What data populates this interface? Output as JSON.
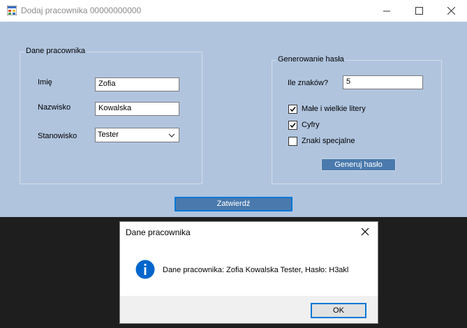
{
  "window": {
    "title": "Dodaj pracownika 00000000000",
    "icons": {
      "app": "app-form-icon",
      "minimize": "minimize-icon",
      "maximize": "maximize-icon",
      "close": "close-icon"
    }
  },
  "employee_group": {
    "title": "Dane pracownika",
    "first_name_label": "Imię",
    "first_name_value": "Zofia",
    "last_name_label": "Nazwisko",
    "last_name_value": "Kowalska",
    "position_label": "Stanowisko",
    "position_value": "Tester"
  },
  "password_group": {
    "title": "Generowanie hasła",
    "length_label": "Ile znaków?",
    "length_value": "5",
    "checkboxes": [
      {
        "label": "Małe i wielkie litery",
        "checked": true
      },
      {
        "label": "Cyfry",
        "checked": true
      },
      {
        "label": "Znaki specjalne",
        "checked": false
      }
    ],
    "generate_button": "Generuj hasło"
  },
  "submit_button": "Zatwierdź",
  "dialog": {
    "title": "Dane pracownika",
    "message": "Dane pracownika: Zofia Kowalska Tester, Hasło: H3akl",
    "ok_button": "OK",
    "icon": "info-icon"
  },
  "colors": {
    "form_background": "#b0c4de",
    "button_blue": "#4a7aad",
    "info_blue": "#0066cc",
    "desktop_dark": "#1e1e1e"
  }
}
